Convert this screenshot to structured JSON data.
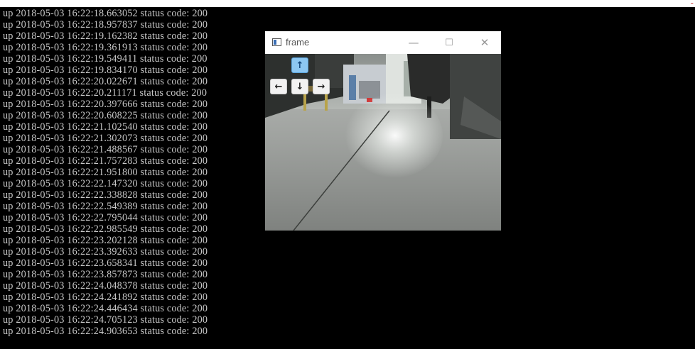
{
  "console": {
    "lines": [
      "up 2018-05-03 16:22:18.663052 status code: 200",
      "up 2018-05-03 16:22:18.957837 status code: 200",
      "up 2018-05-03 16:22:19.162382 status code: 200",
      "up 2018-05-03 16:22:19.361913 status code: 200",
      "up 2018-05-03 16:22:19.549411 status code: 200",
      "up 2018-05-03 16:22:19.834170 status code: 200",
      "up 2018-05-03 16:22:20.022671 status code: 200",
      "up 2018-05-03 16:22:20.211171 status code: 200",
      "up 2018-05-03 16:22:20.397666 status code: 200",
      "up 2018-05-03 16:22:20.608225 status code: 200",
      "up 2018-05-03 16:22:21.102540 status code: 200",
      "up 2018-05-03 16:22:21.302073 status code: 200",
      "up 2018-05-03 16:22:21.488567 status code: 200",
      "up 2018-05-03 16:22:21.757283 status code: 200",
      "up 2018-05-03 16:22:21.951800 status code: 200",
      "up 2018-05-03 16:22:22.147320 status code: 200",
      "up 2018-05-03 16:22:22.338828 status code: 200",
      "up 2018-05-03 16:22:22.549389 status code: 200",
      "up 2018-05-03 16:22:22.795044 status code: 200",
      "up 2018-05-03 16:22:22.985549 status code: 200",
      "up 2018-05-03 16:22:23.202128 status code: 200",
      "up 2018-05-03 16:22:23.392633 status code: 200",
      "up 2018-05-03 16:22:23.658341 status code: 200",
      "up 2018-05-03 16:22:23.857873 status code: 200",
      "up 2018-05-03 16:22:24.048378 status code: 200",
      "up 2018-05-03 16:22:24.241892 status code: 200",
      "up 2018-05-03 16:22:24.446434 status code: 200",
      "up 2018-05-03 16:22:24.705123 status code: 200",
      "up 2018-05-03 16:22:24.903653 status code: 200"
    ],
    "text_color": "#c8c8c8",
    "background": "#000000"
  },
  "frame_window": {
    "title": "frame",
    "icon": "app-window-icon",
    "controls": {
      "minimize": "—",
      "maximize": "☐",
      "close": "✕"
    },
    "arrow_controls": {
      "up": "↑",
      "left": "←",
      "down": "↓",
      "right": "→",
      "active": "up",
      "active_color": "#8cc7f2"
    }
  }
}
